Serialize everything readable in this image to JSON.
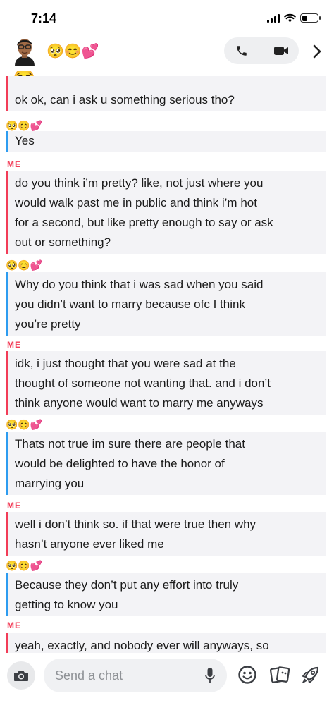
{
  "status_bar": {
    "time": "7:14"
  },
  "header": {
    "title_emojis": "🥺😊💕",
    "call_icon": "phone-icon",
    "video_icon": "video-icon",
    "more_icon": "chevron-right-icon"
  },
  "conversation": {
    "top_emoji": "😂",
    "me_label": "ME",
    "friend_label": "🥺😊💕",
    "messages": [
      {
        "sender": "me",
        "text": "ok ok, can i ask u something serious tho?"
      },
      {
        "sender": "friend",
        "text": "Yes"
      },
      {
        "sender": "me",
        "lines": [
          "do you think i’m pretty? like, not just where you",
          "would walk past me in public and think i’m hot",
          "for a second, but like pretty enough to say or ask",
          "out or something?"
        ]
      },
      {
        "sender": "friend",
        "lines": [
          "Why do you think that i was sad when you said",
          "you didn’t want to marry because ofc I think",
          "you’re pretty"
        ]
      },
      {
        "sender": "me",
        "lines": [
          "idk, i just thought that you were sad at the",
          "thought of someone not wanting that. and i don’t",
          "think anyone would want to marry me anyways"
        ]
      },
      {
        "sender": "friend",
        "lines": [
          "Thats not true im sure there are people that",
          "would be delighted to have the honor of",
          "marrying you"
        ]
      },
      {
        "sender": "me",
        "lines": [
          "well i don’t think so. if that were true then why",
          "hasn’t anyone ever liked me"
        ]
      },
      {
        "sender": "friend",
        "lines": [
          "Because they don’t put any effort into truly",
          "getting to know you"
        ]
      },
      {
        "sender": "me",
        "text": "yeah, exactly, and nobody ever will anyways, so"
      }
    ]
  },
  "input_bar": {
    "placeholder": "Send a chat",
    "icons": [
      "camera-icon",
      "microphone-icon",
      "smiley-icon",
      "sticker-icon",
      "rocket-icon"
    ]
  },
  "colors": {
    "me_accent": "#f23c57",
    "friend_accent": "#2d9cf0",
    "bubble_bg": "#f3f3f6"
  }
}
